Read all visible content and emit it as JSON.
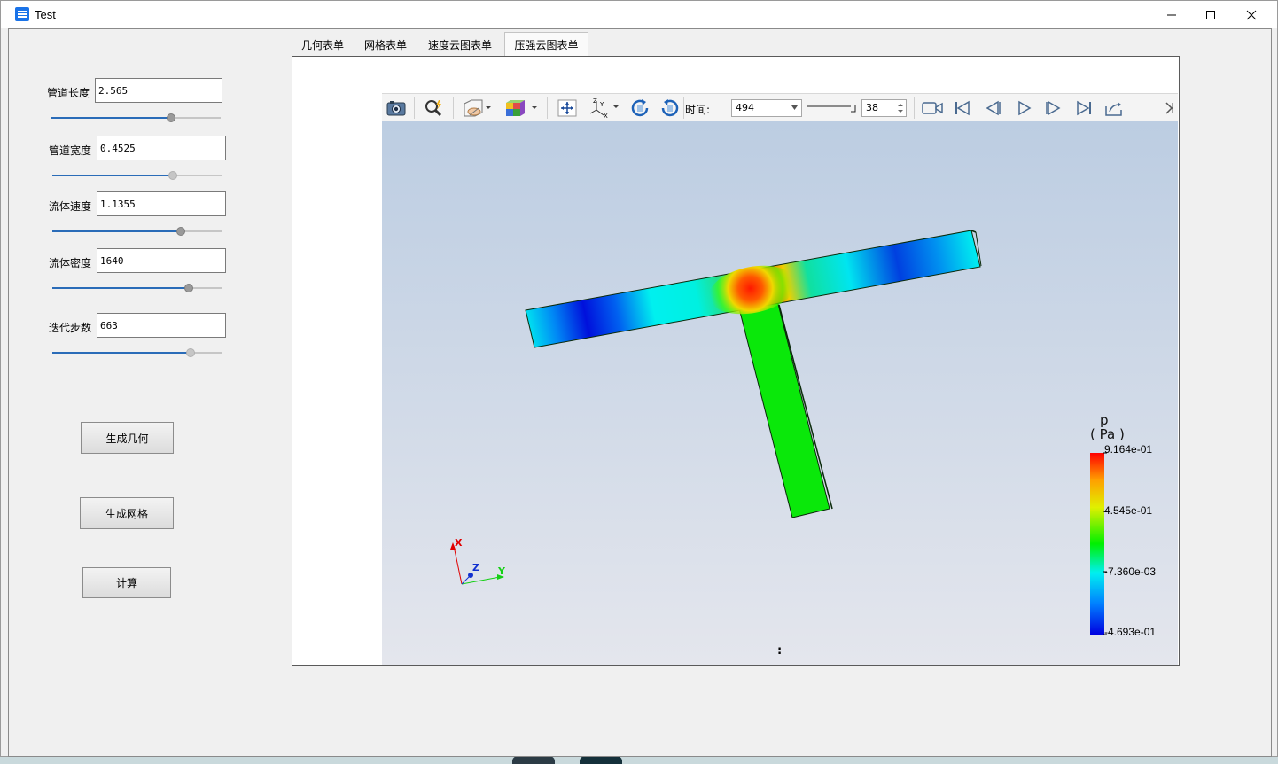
{
  "window": {
    "title": "Test"
  },
  "form": {
    "fields": [
      {
        "label": "管道长度",
        "value": "2.565",
        "slider_fraction": 0.72
      },
      {
        "label": "管道宽度",
        "value": "0.4525",
        "slider_fraction": 0.72
      },
      {
        "label": "流体速度",
        "value": "1.1355",
        "slider_fraction": 0.77
      },
      {
        "label": "流体密度",
        "value": "1640",
        "slider_fraction": 0.82
      },
      {
        "label": "迭代步数",
        "value": "663",
        "slider_fraction": 0.83
      }
    ],
    "buttons": {
      "geometry": "生成几何",
      "mesh": "生成网格",
      "compute": "计算"
    }
  },
  "tabs": [
    {
      "label": "几何表单",
      "active": false
    },
    {
      "label": "网格表单",
      "active": false
    },
    {
      "label": "速度云图表单",
      "active": false
    },
    {
      "label": "压强云图表单",
      "active": true
    }
  ],
  "toolbar": {
    "time_label": "时间:",
    "time_value": "494",
    "step_value": "38",
    "icons": [
      "camera-icon",
      "zoom-icon",
      "visibility-icon",
      "color-cube-icon",
      "reset-camera-icon",
      "axes-icon",
      "rotate-cw-icon",
      "rotate-ccw-icon",
      "record-icon",
      "first-frame-icon",
      "prev-frame-icon",
      "play-icon",
      "next-frame-icon",
      "last-frame-icon",
      "export-icon"
    ]
  },
  "viewport": {
    "legend": {
      "title": "p",
      "unit": "( Pa )",
      "labels": [
        "9.164e-01",
        "4.545e-01",
        "-7.360e-03",
        "-4.693e-01"
      ]
    },
    "axes": {
      "x": "X",
      "y": "Y",
      "z": "Z"
    },
    "status": ":"
  },
  "colors": {
    "accent": "#2a6cb8",
    "axis_x": "#e00000",
    "axis_y": "#14d014",
    "axis_z": "#1030d0"
  }
}
